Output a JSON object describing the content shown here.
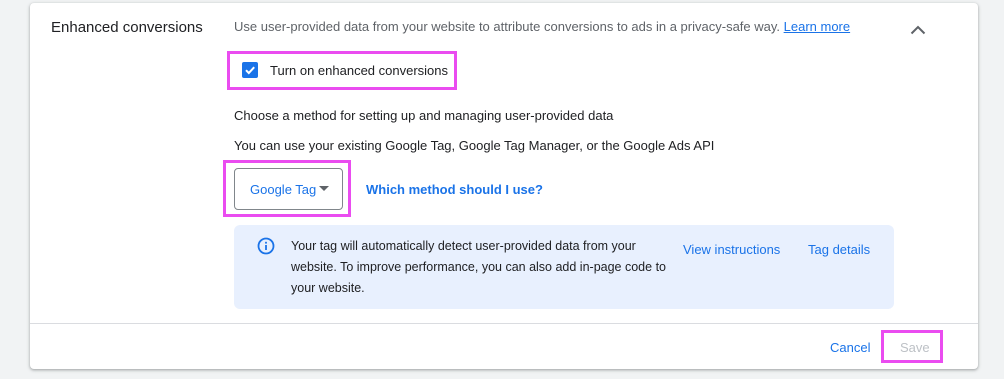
{
  "section": {
    "title": "Enhanced conversions",
    "description": "Use user-provided data from your website to attribute conversions to ads in a privacy-safe way. ",
    "learn_more": "Learn more",
    "collapse_icon": "chevron-up-icon"
  },
  "checkbox": {
    "label": "Turn on enhanced conversions",
    "checked": true
  },
  "method": {
    "heading": "Choose a method for setting up and managing user-provided data",
    "subheading": "You can use your existing Google Tag, Google Tag Manager, or the Google Ads API",
    "selected": "Google Tag",
    "help_link": "Which method should I use?"
  },
  "info": {
    "icon": "info-icon",
    "text": "Your tag will automatically detect user-provided data from your website. To improve performance, you can also add in-page code to your website.",
    "view_instructions": "View instructions",
    "tag_details": "Tag details"
  },
  "footer": {
    "cancel": "Cancel",
    "save": "Save",
    "save_enabled": false
  },
  "colors": {
    "accent": "#1a73e8",
    "highlight": "#ea4cf0",
    "info_background": "#e8f0fe",
    "disabled_text": "#bdc1c6"
  }
}
